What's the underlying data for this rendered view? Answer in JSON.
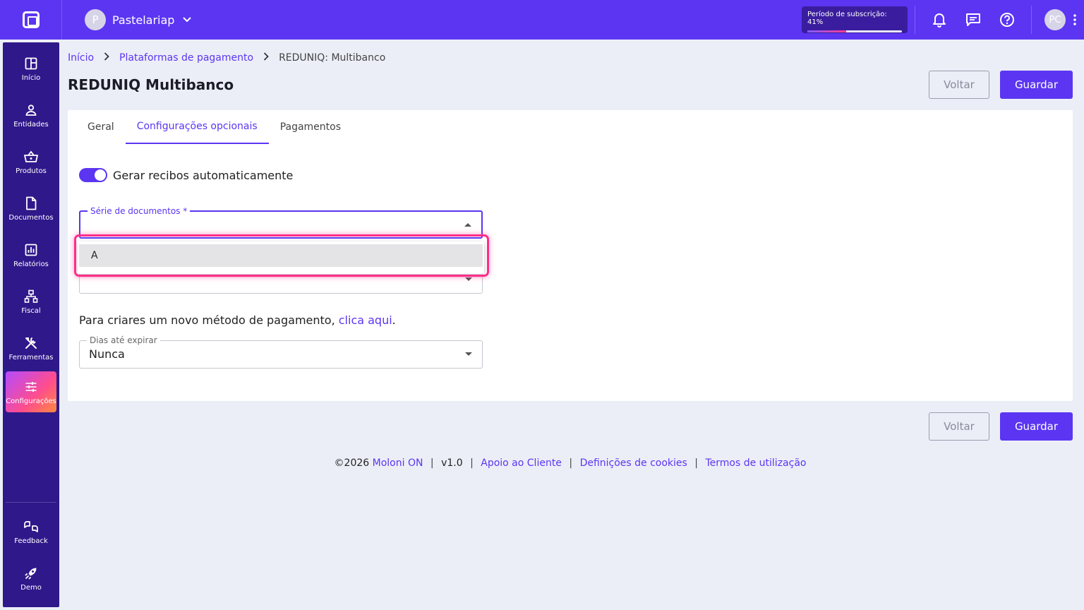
{
  "topbar": {
    "company_initial": "P",
    "company_name": "Pastelariap",
    "subscription_label": "Período de subscrição: 41%",
    "subscription_progress_percent": 41,
    "user_initials": "PC"
  },
  "sidebar": {
    "items": [
      {
        "label": "Início",
        "icon": "dashboard-icon"
      },
      {
        "label": "Entidades",
        "icon": "person-icon"
      },
      {
        "label": "Produtos",
        "icon": "basket-icon"
      },
      {
        "label": "Documentos",
        "icon": "document-icon"
      },
      {
        "label": "Relatórios",
        "icon": "report-icon"
      },
      {
        "label": "Fiscal",
        "icon": "fiscal-icon"
      },
      {
        "label": "Ferramentas",
        "icon": "tools-icon"
      },
      {
        "label": "Configurações",
        "icon": "sliders-icon",
        "active": true
      }
    ],
    "bottom_items": [
      {
        "label": "Feedback",
        "icon": "feedback-icon"
      },
      {
        "label": "Demo",
        "icon": "rocket-icon"
      }
    ]
  },
  "breadcrumb": {
    "home": "Início",
    "parent": "Plataformas de pagamento",
    "current": "REDUNIQ: Multibanco"
  },
  "page": {
    "title": "REDUNIQ Multibanco",
    "back_label": "Voltar",
    "save_label": "Guardar"
  },
  "tabs": [
    {
      "label": "Geral"
    },
    {
      "label": "Configurações opcionais",
      "active": true
    },
    {
      "label": "Pagamentos"
    }
  ],
  "form": {
    "auto_receipts_label": "Gerar recibos automaticamente",
    "auto_receipts_on": true,
    "document_series_label": "Série de documentos *",
    "document_series_value": "",
    "info_text": "Para criares um novo método de pagamento, ",
    "info_link": "clica aqui",
    "info_end": ".",
    "expiry_label": "Dias até expirar",
    "expiry_value": "Nunca"
  },
  "dropdown": {
    "options": [
      "A"
    ]
  },
  "footer": {
    "copyright": "©2026",
    "brand": "Moloni ON",
    "version": "v1.0",
    "support": "Apoio ao Cliente",
    "cookies": "Definições de cookies",
    "terms": "Termos de utilização"
  },
  "colors": {
    "brand": "#5b35f2",
    "sidebar": "#2f188a",
    "highlight": "#ff2d8a"
  }
}
